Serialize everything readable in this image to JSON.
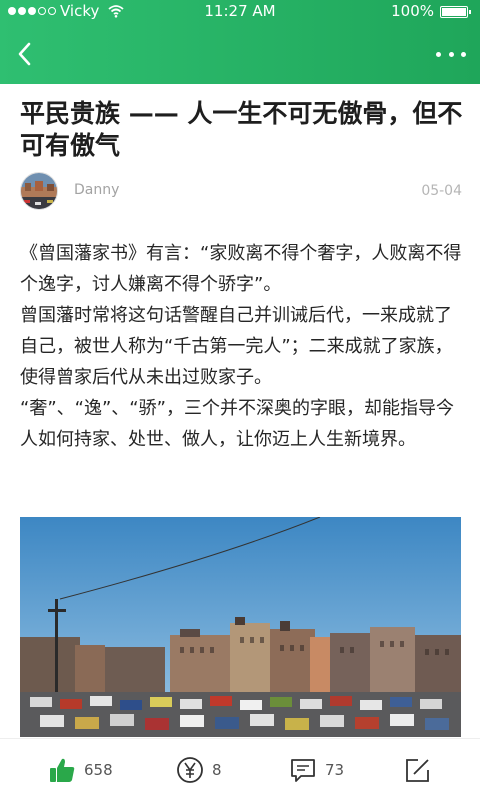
{
  "status_bar": {
    "carrier": "Vicky",
    "time": "11:27 AM",
    "battery": "100%"
  },
  "nav": {
    "back_icon": "chevron-left-icon",
    "more_icon": "more-dots-icon"
  },
  "article": {
    "title": "平民贵族 —— 人一生不可无傲骨，但不可有傲气",
    "author": "Danny",
    "date": "05-04",
    "paragraphs": [
      "《曾国藩家书》有言：“家败离不得个奢字，人败离不得个逸字，讨人嫌离不得个骄字”。",
      "曾国藩时常将这句话警醒自己并训诫后代，一来成就了自己，被世人称为“千古第一完人”；二来成就了家族，使得曾家后代从未出过败家子。",
      "“奢”、“逸”、“骄”，三个并不深奥的字眼，却能指导今人如何持家、处世、做人，让你迈上人生新境界。"
    ]
  },
  "actions": {
    "likes": "658",
    "rewards": "8",
    "comments": "73"
  },
  "colors": {
    "header_green": "#22b060",
    "like_green": "#2aa84a"
  }
}
